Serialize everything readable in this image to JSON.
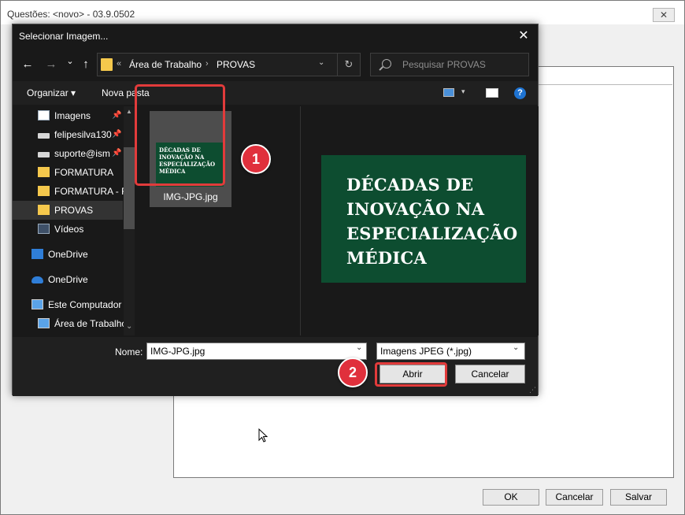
{
  "background_window": {
    "title": "Questões: <novo> - 03.9.0502",
    "close_glyph": "✕",
    "buttons": {
      "ok": "OK",
      "cancel": "Cancelar",
      "save": "Salvar"
    }
  },
  "dialog": {
    "title": "Selecionar Imagem...",
    "close_glyph": "✕",
    "nav": {
      "back": "←",
      "forward": "→",
      "recent": "⌄",
      "up": "↑"
    },
    "address": {
      "chevron": "«",
      "crumbs": [
        "Área de Trabalho",
        "PROVAS"
      ],
      "sep": "›",
      "dropdown": "⌄"
    },
    "refresh_glyph": "↻",
    "search": {
      "placeholder": "Pesquisar PROVAS"
    },
    "toolbar": {
      "organize": "Organizar ▾",
      "new_folder": "Nova pasta",
      "help": "?",
      "view_caret": "▾"
    },
    "sidebar": {
      "items": [
        {
          "label": "Imagens",
          "icon": "images-icon",
          "pinned": true
        },
        {
          "label": "felipesilva130",
          "icon": "network-drive-icon",
          "pinned": true
        },
        {
          "label": "suporte@ism",
          "icon": "network-drive-icon",
          "pinned": true
        },
        {
          "label": "FORMATURA",
          "icon": "folder-icon",
          "pinned": false
        },
        {
          "label": "FORMATURA - R",
          "icon": "folder-icon",
          "pinned": false
        },
        {
          "label": "PROVAS",
          "icon": "folder-icon",
          "pinned": false,
          "selected": true
        },
        {
          "label": "Vídeos",
          "icon": "videos-icon",
          "pinned": false
        },
        {
          "label": "OneDrive",
          "icon": "onedrive-business-icon",
          "pinned": false
        },
        {
          "label": "OneDrive",
          "icon": "onedrive-icon",
          "pinned": false
        },
        {
          "label": "Este Computador",
          "icon": "computer-icon",
          "pinned": false
        },
        {
          "label": "Área de Trabalho",
          "icon": "desktop-icon",
          "pinned": false
        }
      ],
      "pin_glyph": "📌",
      "scroll_up": "▲",
      "scroll_down": "⌄"
    },
    "file": {
      "name": "IMG-JPG.jpg",
      "thumb_text": "DÉCADAS DE INOVAÇÃO NA ESPECIALIZAÇÃO MÉDICA"
    },
    "preview": {
      "lines": [
        "DÉCADAS DE",
        "INOVAÇÃO NA",
        "ESPECIALIZAÇÃO",
        "MÉDICA"
      ]
    },
    "filename": {
      "label": "Nome:",
      "value": "IMG-JPG.jpg",
      "dropdown": "⌄"
    },
    "filter": {
      "value": "Imagens JPEG (*.jpg)",
      "dropdown": "⌄"
    },
    "buttons": {
      "open": "Abrir",
      "cancel": "Cancelar"
    },
    "grip": "⋰"
  },
  "annotations": {
    "step1": "1",
    "step2": "2",
    "color": "#e0303c"
  },
  "colors": {
    "dialog_bg": "#191919",
    "thumbnail_green": "#0d4d30",
    "folder_yellow": "#f5c84c",
    "highlight_red": "#e23b3b"
  }
}
